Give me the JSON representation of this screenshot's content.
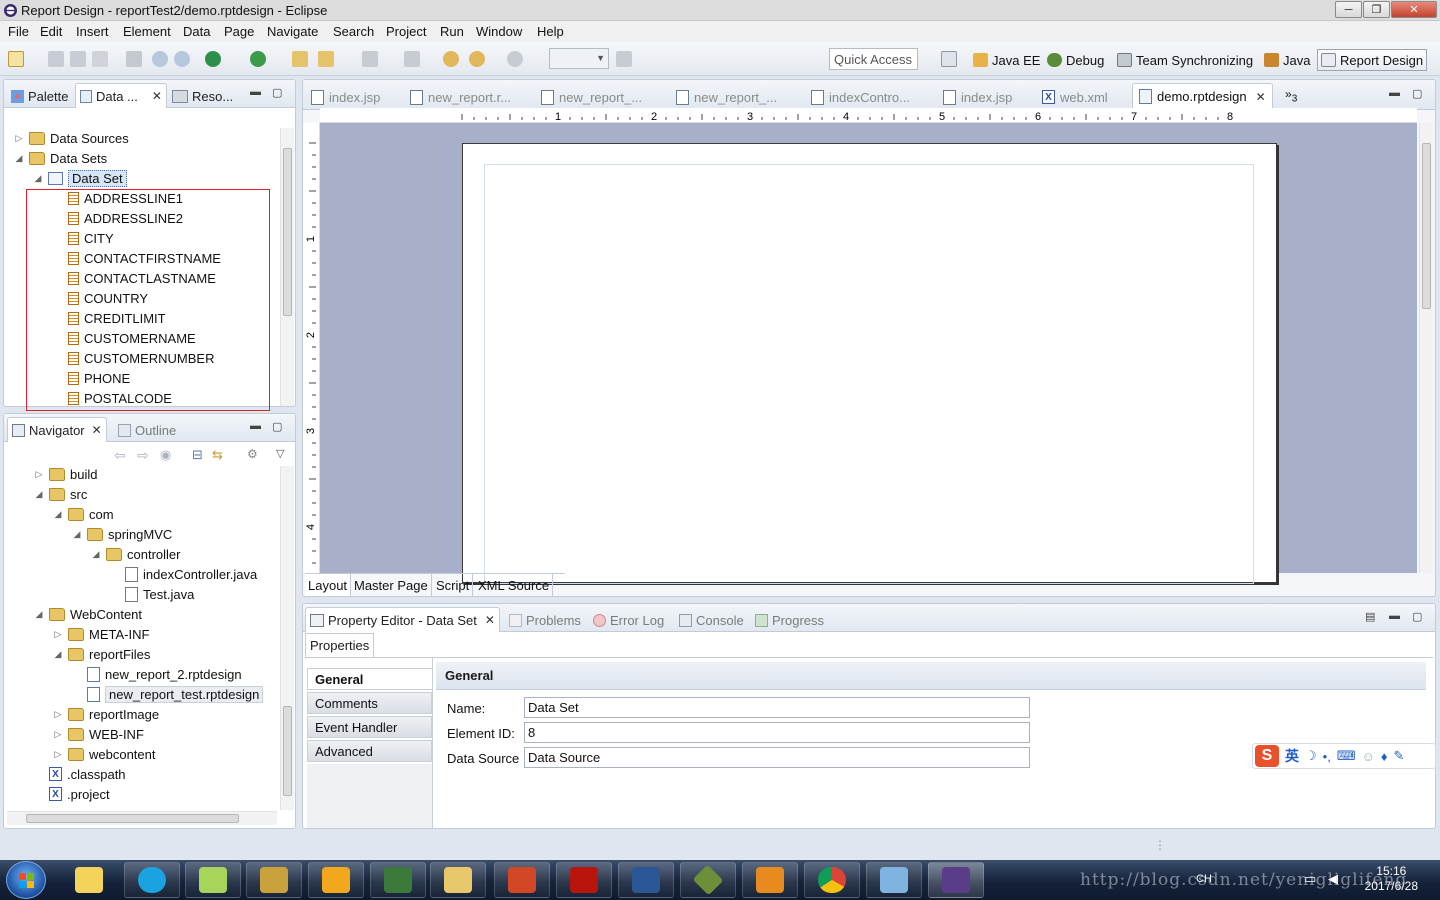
{
  "window": {
    "title": "Report Design - reportTest2/demo.rptdesign - Eclipse"
  },
  "menu": [
    "File",
    "Edit",
    "Insert",
    "Element",
    "Data",
    "Page",
    "Navigate",
    "Search",
    "Project",
    "Run",
    "Window",
    "Help"
  ],
  "toolbar": {
    "quick_access": "Quick Access",
    "perspectives": [
      "Java EE",
      "Debug",
      "Team Synchronizing",
      "Java",
      "Report Design"
    ]
  },
  "data_explorer": {
    "tabs": [
      "Palette",
      "Data ...",
      "Reso..."
    ],
    "tree": {
      "data_sources": "Data Sources",
      "data_sets": "Data Sets",
      "data_set": "Data Set",
      "columns": [
        "ADDRESSLINE1",
        "ADDRESSLINE2",
        "CITY",
        "CONTACTFIRSTNAME",
        "CONTACTLASTNAME",
        "COUNTRY",
        "CREDITLIMIT",
        "CUSTOMERNAME",
        "CUSTOMERNUMBER",
        "PHONE",
        "POSTALCODE"
      ]
    }
  },
  "navigator": {
    "tabs": [
      "Navigator",
      "Outline"
    ],
    "items": [
      "build",
      "src",
      "com",
      "springMVC",
      "controller",
      "indexController.java",
      "Test.java",
      "WebContent",
      "META-INF",
      "reportFiles",
      "new_report_2.rptdesign",
      "new_report_test.rptdesign",
      "reportImage",
      "WEB-INF",
      "webcontent",
      ".classpath",
      ".project"
    ]
  },
  "editor": {
    "tabs": [
      "index.jsp",
      "new_report.r...",
      "new_report_...",
      "new_report_...",
      "indexContro...",
      "index.jsp",
      "web.xml",
      "demo.rptdesign"
    ],
    "overflow_count": "3",
    "ruler_numbers": [
      "1",
      "2",
      "3",
      "4",
      "5",
      "6",
      "7",
      "8"
    ],
    "vruler_numbers": [
      "1",
      "2",
      "3",
      "4"
    ],
    "bottom_tabs": [
      "Layout",
      "Master Page",
      "Script",
      "XML Source"
    ]
  },
  "property_editor": {
    "tabs": [
      "Property Editor - Data Set",
      "Problems",
      "Error Log",
      "Console",
      "Progress"
    ],
    "subtab": "Properties",
    "categories": [
      "General",
      "Comments",
      "Event Handler",
      "Advanced"
    ],
    "section_title": "General",
    "fields": [
      {
        "label": "Name:",
        "value": "Data Set"
      },
      {
        "label": "Element ID:",
        "value": "8"
      },
      {
        "label": "Data Source",
        "value": "Data Source"
      }
    ]
  },
  "ime": {
    "label": "英"
  },
  "taskbar": {
    "ime": "CH",
    "time": "15:16",
    "date": "2017/6/28"
  },
  "watermark": "http://blog.csdn.net/yenigliglifeng",
  "colors": {
    "selection_border": "#e0202a",
    "canvas_bg": "#a7b0c8",
    "taskbar": "#15223a"
  }
}
